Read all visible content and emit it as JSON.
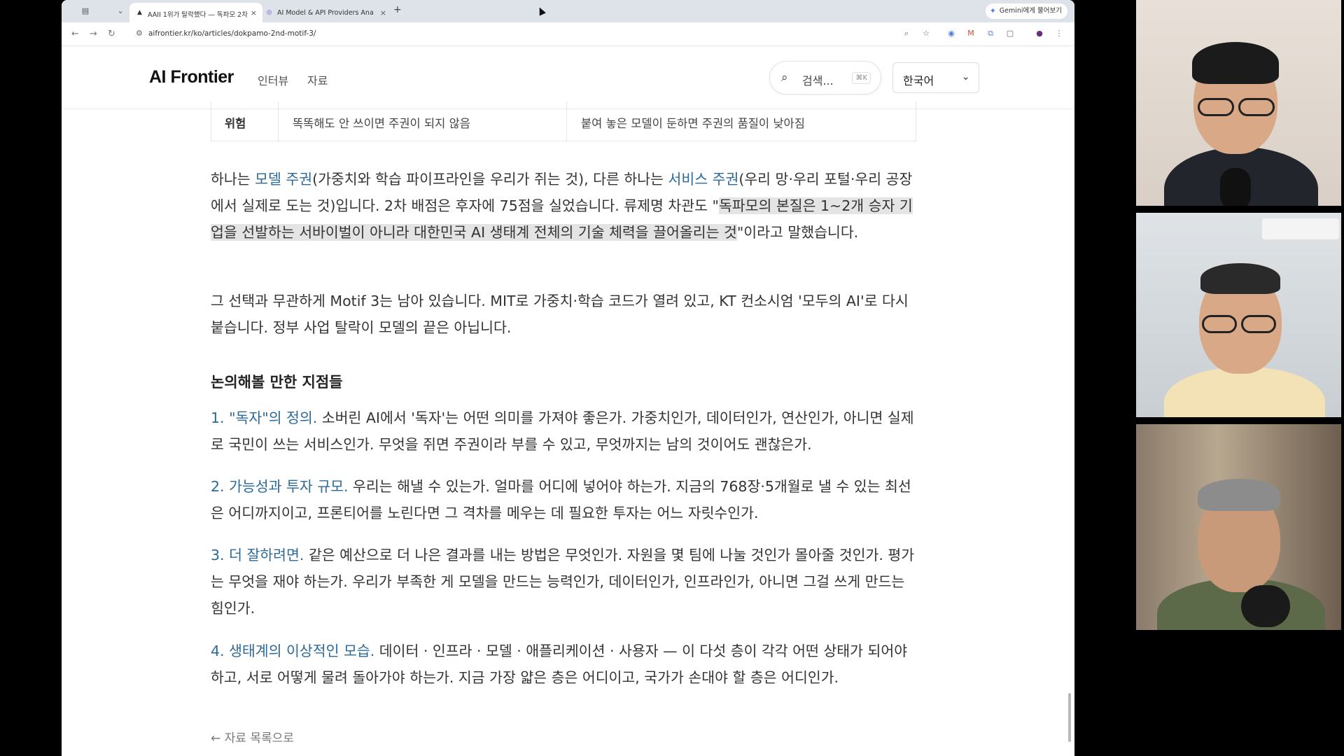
{
  "browser": {
    "tabs": [
      {
        "title": "AAII 1위가 탈락했다 — 독파모 2차",
        "active": true
      },
      {
        "title": "AI Model & API Providers Ana",
        "active": false
      }
    ],
    "gemini_label": "Gemini에게 물어보기",
    "url": "aifrontier.kr/ko/articles/dokpamo-2nd-motif-3/"
  },
  "site": {
    "logo": "AI Frontier",
    "nav": [
      "인터뷰",
      "자료"
    ],
    "search_placeholder": "검색...",
    "search_shortcut": "⌘K",
    "language": "한국어"
  },
  "table_row": {
    "label": "위험",
    "col1": "똑똑해도 안 쓰이면 주권이 되지 않음",
    "col2": "붙여 놓은 모델이 둔하면 주권의 품질이 낮아짐"
  },
  "article": {
    "p1": {
      "a": "하나는 ",
      "hl1": "모델 주권",
      "b": "(가중치와 학습 파이프라인을 우리가 쥐는 것), 다른 하나는 ",
      "hl2": "서비스 주권",
      "c": "(우리 망·우리 포털·우리 공장에서 실제로 도는 것)입니다. 2차 배점은 후자에 75점을 실었습니다. 류제명 차관도 \"",
      "quote": "독파모의 본질은 1~2개 승자 기업을 선발하는 서바이벌이 아니라 대한민국 AI 생태계 전체의 기술 체력을 끌어올리는 것",
      "d": "\"이라고 말했습니다."
    },
    "p2": "그 선택과 무관하게 Motif 3는 남아 있습니다. MIT로 가중치·학습 코드가 열려 있고, KT 컨소시엄 '모두의 AI'로 다시 붙습니다. 정부 사업 탈락이 모델의 끝은 아닙니다.",
    "section_title": "논의해볼 만한 지점들",
    "points": [
      {
        "head": "1. \"독자\"의 정의.",
        "body": " 소버린 AI에서 '독자'는 어떤 의미를 가져야 좋은가. 가중치인가, 데이터인가, 연산인가, 아니면 실제로 국민이 쓰는 서비스인가. 무엇을 쥐면 주권이라 부를 수 있고, 무엇까지는 남의 것이어도 괜찮은가."
      },
      {
        "head": "2. 가능성과 투자 규모.",
        "body": " 우리는 해낼 수 있는가. 얼마를 어디에 넣어야 하는가. 지금의 768장·5개월로 낼 수 있는 최선은 어디까지이고, 프론티어를 노린다면 그 격차를 메우는 데 필요한 투자는 어느 자릿수인가."
      },
      {
        "head": "3. 더 잘하려면.",
        "body": " 같은 예산으로 더 나은 결과를 내는 방법은 무엇인가. 자원을 몇 팀에 나눌 것인가 몰아줄 것인가. 평가는 무엇을 재야 하는가. 우리가 부족한 게 모델을 만드는 능력인가, 데이터인가, 인프라인가, 아니면 그걸 쓰게 만드는 힘인가."
      },
      {
        "head": "4. 생태계의 이상적인 모습.",
        "body": " 데이터 · 인프라 · 모델 · 애플리케이션 · 사용자 — 이 다섯 층이 각각 어떤 상태가 되어야 하고, 서로 어떻게 물려 돌아가야 하는가. 지금 가장 얇은 층은 어디이고, 국가가 손대야 할 층은 어디인가."
      }
    ],
    "back_link": "← 자료 목록으로"
  },
  "colors": {
    "accent": "#2c6a9a",
    "selection": "#e4e4e4"
  }
}
